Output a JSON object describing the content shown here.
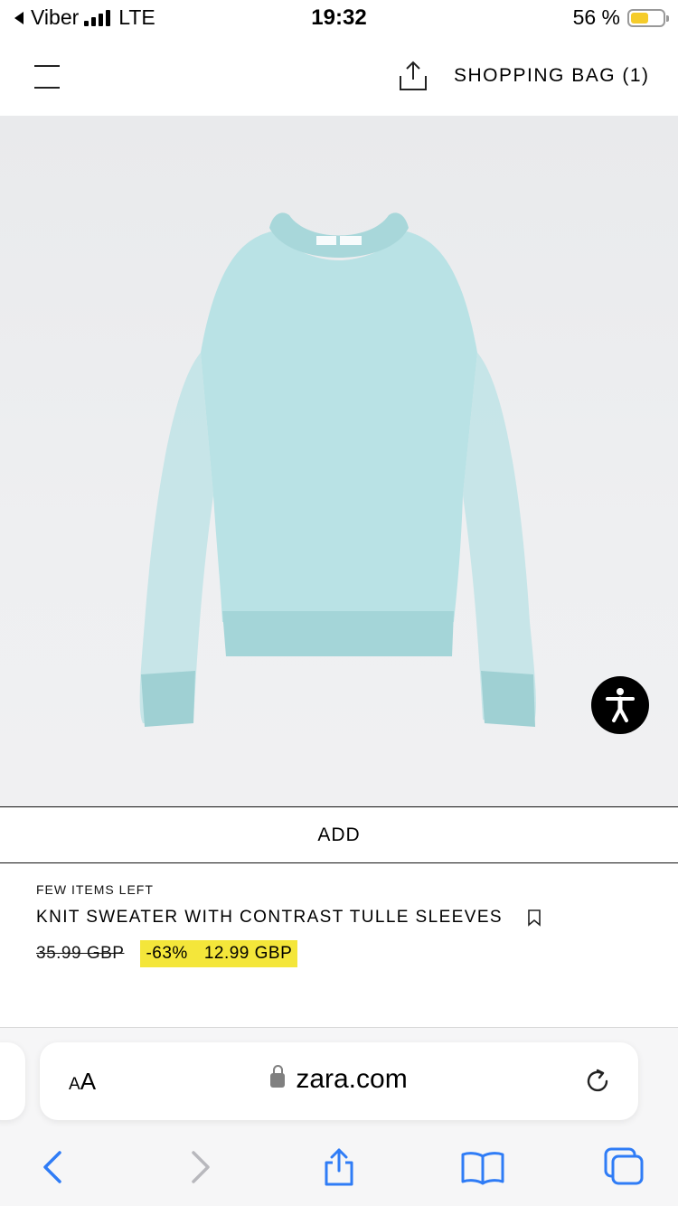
{
  "status_bar": {
    "back_app": "Viber",
    "network": "LTE",
    "time": "19:32",
    "battery_percent": "56 %",
    "battery_level": 0.56
  },
  "header": {
    "menu_icon": "hamburger-icon",
    "share_icon": "share-icon",
    "bag_label": "SHOPPING BAG (1)"
  },
  "product": {
    "add_label": "ADD",
    "availability": "FEW ITEMS LEFT",
    "name": "KNIT SWEATER WITH CONTRAST TULLE SLEEVES",
    "original_price": "35.99 GBP",
    "discount": "-63%",
    "sale_price": "12.99 GBP",
    "sale_highlight_color": "#f4e63a"
  },
  "safari": {
    "text_size_small": "A",
    "text_size_large": "A",
    "url": "zara.com",
    "toolbar_icons": [
      "back-icon",
      "forward-icon",
      "share-icon",
      "bookmarks-icon",
      "tabs-icon"
    ]
  },
  "accessibility_button_icon": "accessibility-icon"
}
